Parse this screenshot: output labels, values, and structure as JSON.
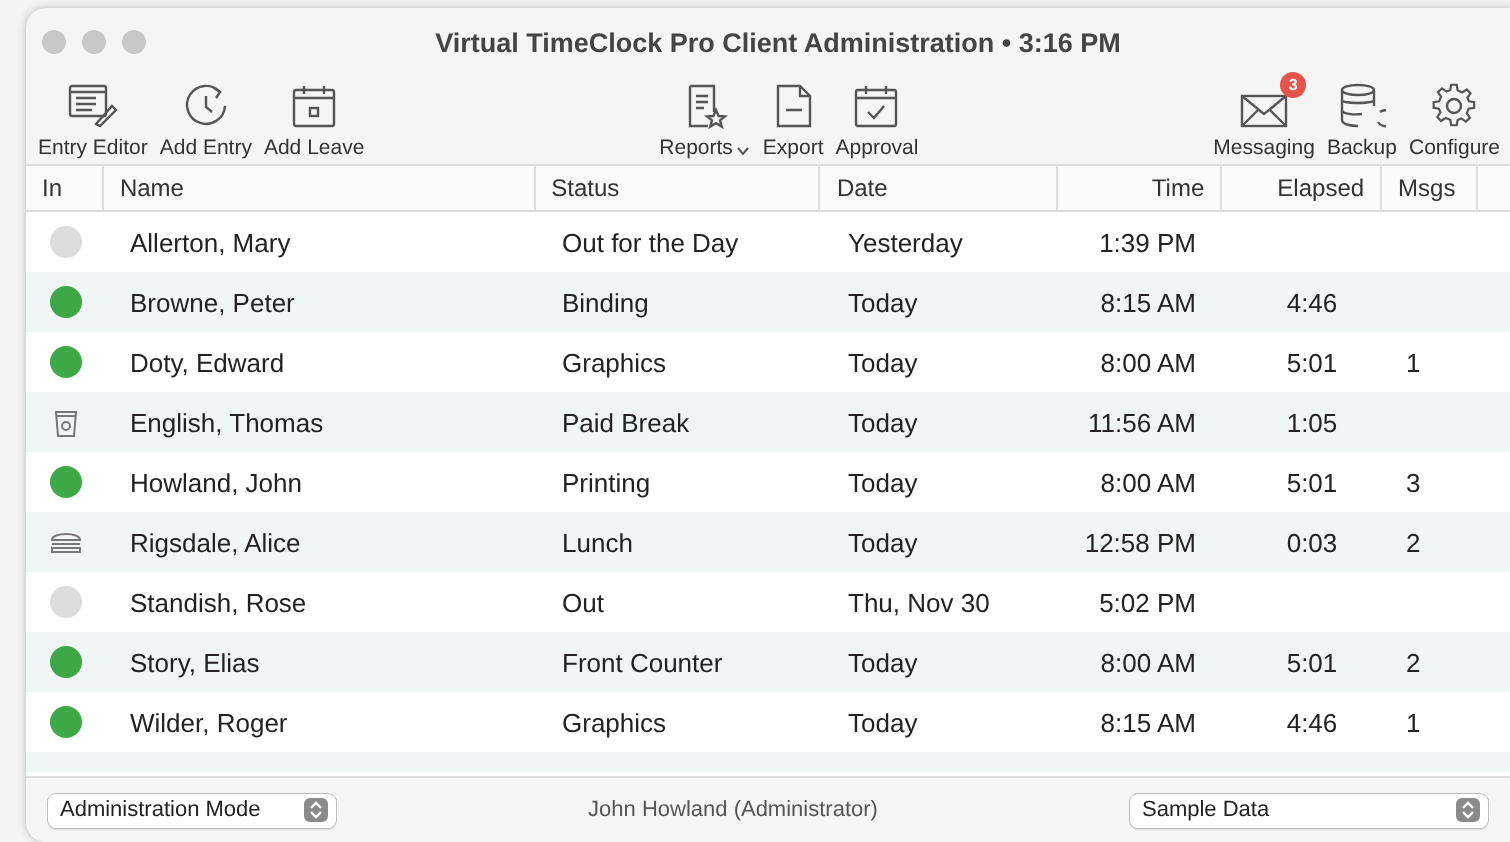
{
  "window": {
    "title": "Virtual TimeClock Pro Client Administration • 3:16 PM"
  },
  "toolbar": {
    "left": [
      {
        "label": "Entry Editor",
        "kind": "editor"
      },
      {
        "label": "Add Entry",
        "kind": "clock"
      },
      {
        "label": "Add Leave",
        "kind": "calendar"
      }
    ],
    "center": [
      {
        "label": "Reports",
        "kind": "report",
        "menu": true
      },
      {
        "label": "Export",
        "kind": "csv",
        "menu": false
      },
      {
        "label": "Approval",
        "kind": "approval",
        "menu": false
      }
    ],
    "right": [
      {
        "label": "Messaging",
        "kind": "mail",
        "badge": "3"
      },
      {
        "label": "Backup",
        "kind": "database"
      },
      {
        "label": "Configure",
        "kind": "gear"
      }
    ]
  },
  "table": {
    "columns": [
      "In",
      "Name",
      "Status",
      "Date",
      "Time",
      "Elapsed",
      "Msgs"
    ],
    "rows": [
      {
        "kind": "out",
        "name": "Allerton, Mary",
        "status": "Out for the Day",
        "date": "Yesterday",
        "time": "1:39 PM"
      },
      {
        "kind": "in",
        "name": "Browne, Peter",
        "status": "Binding",
        "date": "Today",
        "time": "8:15 AM",
        "elapsed": "4:46"
      },
      {
        "kind": "in",
        "name": "Doty, Edward",
        "status": "Graphics",
        "date": "Today",
        "time": "8:00 AM",
        "elapsed": "5:01",
        "msgs": "1"
      },
      {
        "kind": "break",
        "name": "English, Thomas",
        "status": "Paid Break",
        "date": "Today",
        "time": "11:56 AM",
        "elapsed": "1:05"
      },
      {
        "kind": "in",
        "name": "Howland, John",
        "status": "Printing",
        "date": "Today",
        "time": "8:00 AM",
        "elapsed": "5:01",
        "msgs": "3"
      },
      {
        "kind": "lunch",
        "name": "Rigsdale, Alice",
        "status": "Lunch",
        "date": "Today",
        "time": "12:58 PM",
        "elapsed": "0:03",
        "msgs": "2"
      },
      {
        "kind": "out",
        "name": "Standish, Rose",
        "status": "Out",
        "date": "Thu, Nov 30",
        "time": "5:02 PM"
      },
      {
        "kind": "in",
        "name": "Story, Elias",
        "status": "Front Counter",
        "date": "Today",
        "time": "8:00 AM",
        "elapsed": "5:01",
        "msgs": "2"
      },
      {
        "kind": "in",
        "name": "Wilder, Roger",
        "status": "Graphics",
        "date": "Today",
        "time": "8:15 AM",
        "elapsed": "4:46",
        "msgs": "1"
      }
    ]
  },
  "status_bar": {
    "mode": "Administration Mode",
    "user": "John Howland (Administrator)",
    "database": "Sample Data"
  }
}
